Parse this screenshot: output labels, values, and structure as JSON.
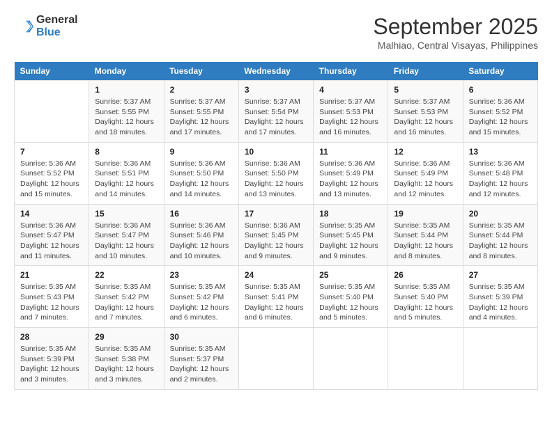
{
  "header": {
    "logo_line1": "General",
    "logo_line2": "Blue",
    "month": "September 2025",
    "location": "Malhiao, Central Visayas, Philippines"
  },
  "weekdays": [
    "Sunday",
    "Monday",
    "Tuesday",
    "Wednesday",
    "Thursday",
    "Friday",
    "Saturday"
  ],
  "weeks": [
    [
      {
        "day": "",
        "info": ""
      },
      {
        "day": "1",
        "info": "Sunrise: 5:37 AM\nSunset: 5:55 PM\nDaylight: 12 hours\nand 18 minutes."
      },
      {
        "day": "2",
        "info": "Sunrise: 5:37 AM\nSunset: 5:55 PM\nDaylight: 12 hours\nand 17 minutes."
      },
      {
        "day": "3",
        "info": "Sunrise: 5:37 AM\nSunset: 5:54 PM\nDaylight: 12 hours\nand 17 minutes."
      },
      {
        "day": "4",
        "info": "Sunrise: 5:37 AM\nSunset: 5:53 PM\nDaylight: 12 hours\nand 16 minutes."
      },
      {
        "day": "5",
        "info": "Sunrise: 5:37 AM\nSunset: 5:53 PM\nDaylight: 12 hours\nand 16 minutes."
      },
      {
        "day": "6",
        "info": "Sunrise: 5:36 AM\nSunset: 5:52 PM\nDaylight: 12 hours\nand 15 minutes."
      }
    ],
    [
      {
        "day": "7",
        "info": "Sunrise: 5:36 AM\nSunset: 5:52 PM\nDaylight: 12 hours\nand 15 minutes."
      },
      {
        "day": "8",
        "info": "Sunrise: 5:36 AM\nSunset: 5:51 PM\nDaylight: 12 hours\nand 14 minutes."
      },
      {
        "day": "9",
        "info": "Sunrise: 5:36 AM\nSunset: 5:50 PM\nDaylight: 12 hours\nand 14 minutes."
      },
      {
        "day": "10",
        "info": "Sunrise: 5:36 AM\nSunset: 5:50 PM\nDaylight: 12 hours\nand 13 minutes."
      },
      {
        "day": "11",
        "info": "Sunrise: 5:36 AM\nSunset: 5:49 PM\nDaylight: 12 hours\nand 13 minutes."
      },
      {
        "day": "12",
        "info": "Sunrise: 5:36 AM\nSunset: 5:49 PM\nDaylight: 12 hours\nand 12 minutes."
      },
      {
        "day": "13",
        "info": "Sunrise: 5:36 AM\nSunset: 5:48 PM\nDaylight: 12 hours\nand 12 minutes."
      }
    ],
    [
      {
        "day": "14",
        "info": "Sunrise: 5:36 AM\nSunset: 5:47 PM\nDaylight: 12 hours\nand 11 minutes."
      },
      {
        "day": "15",
        "info": "Sunrise: 5:36 AM\nSunset: 5:47 PM\nDaylight: 12 hours\nand 10 minutes."
      },
      {
        "day": "16",
        "info": "Sunrise: 5:36 AM\nSunset: 5:46 PM\nDaylight: 12 hours\nand 10 minutes."
      },
      {
        "day": "17",
        "info": "Sunrise: 5:36 AM\nSunset: 5:45 PM\nDaylight: 12 hours\nand 9 minutes."
      },
      {
        "day": "18",
        "info": "Sunrise: 5:35 AM\nSunset: 5:45 PM\nDaylight: 12 hours\nand 9 minutes."
      },
      {
        "day": "19",
        "info": "Sunrise: 5:35 AM\nSunset: 5:44 PM\nDaylight: 12 hours\nand 8 minutes."
      },
      {
        "day": "20",
        "info": "Sunrise: 5:35 AM\nSunset: 5:44 PM\nDaylight: 12 hours\nand 8 minutes."
      }
    ],
    [
      {
        "day": "21",
        "info": "Sunrise: 5:35 AM\nSunset: 5:43 PM\nDaylight: 12 hours\nand 7 minutes."
      },
      {
        "day": "22",
        "info": "Sunrise: 5:35 AM\nSunset: 5:42 PM\nDaylight: 12 hours\nand 7 minutes."
      },
      {
        "day": "23",
        "info": "Sunrise: 5:35 AM\nSunset: 5:42 PM\nDaylight: 12 hours\nand 6 minutes."
      },
      {
        "day": "24",
        "info": "Sunrise: 5:35 AM\nSunset: 5:41 PM\nDaylight: 12 hours\nand 6 minutes."
      },
      {
        "day": "25",
        "info": "Sunrise: 5:35 AM\nSunset: 5:40 PM\nDaylight: 12 hours\nand 5 minutes."
      },
      {
        "day": "26",
        "info": "Sunrise: 5:35 AM\nSunset: 5:40 PM\nDaylight: 12 hours\nand 5 minutes."
      },
      {
        "day": "27",
        "info": "Sunrise: 5:35 AM\nSunset: 5:39 PM\nDaylight: 12 hours\nand 4 minutes."
      }
    ],
    [
      {
        "day": "28",
        "info": "Sunrise: 5:35 AM\nSunset: 5:39 PM\nDaylight: 12 hours\nand 3 minutes."
      },
      {
        "day": "29",
        "info": "Sunrise: 5:35 AM\nSunset: 5:38 PM\nDaylight: 12 hours\nand 3 minutes."
      },
      {
        "day": "30",
        "info": "Sunrise: 5:35 AM\nSunset: 5:37 PM\nDaylight: 12 hours\nand 2 minutes."
      },
      {
        "day": "",
        "info": ""
      },
      {
        "day": "",
        "info": ""
      },
      {
        "day": "",
        "info": ""
      },
      {
        "day": "",
        "info": ""
      }
    ]
  ]
}
